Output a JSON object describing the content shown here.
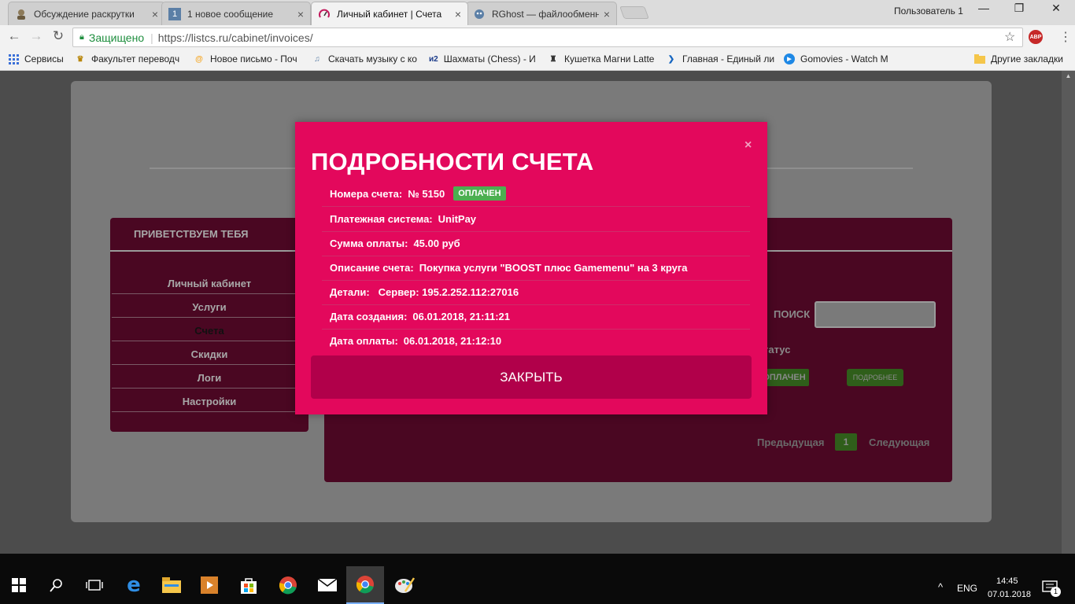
{
  "browser": {
    "tabs": [
      {
        "title": "Обсуждение раскрутки",
        "icon": "user-avatar-icon"
      },
      {
        "title": "1 новое сообщение",
        "icon": "message-icon",
        "badge": "1"
      },
      {
        "title": "Личный кабинет | Счета",
        "icon": "gauge-icon"
      },
      {
        "title": "RGhost — файлообменн",
        "icon": "ghost-icon"
      }
    ],
    "user": "Пользователь 1",
    "secure_label": "Защищено",
    "url": "https://listcs.ru/cabinet/invoices/",
    "abp": "ABP",
    "bookmarks": [
      {
        "label": "Сервисы",
        "icon": "apps-icon"
      },
      {
        "label": "Факультет переводч",
        "icon": "faculty-icon"
      },
      {
        "label": "Новое письмо - Поч",
        "icon": "mail-icon"
      },
      {
        "label": "Скачать музыку с ко",
        "icon": "music-icon"
      },
      {
        "label": "Шахматы (Chess) - И",
        "icon": "chess-icon",
        "prefix": "и2"
      },
      {
        "label": "Кушетка Магни Latte",
        "icon": "couch-icon"
      },
      {
        "label": "Главная - Единый ли",
        "icon": "gis-icon"
      },
      {
        "label": "Gomovies - Watch M",
        "icon": "play-icon"
      }
    ],
    "other_bookmarks": "Другие закладки"
  },
  "page": {
    "sidebar": {
      "greeting": "ПРИВЕТСТВУЕМ ТЕБЯ",
      "items": [
        "Личный кабинет",
        "Услуги",
        "Счета",
        "Скидки",
        "Логи",
        "Настройки"
      ],
      "active_index": 2
    },
    "search_label": "ПОИСК",
    "status_label": "татус",
    "row_status": "ОПЛАЧЕН",
    "details_button": "ПОДРОБНЕЕ",
    "pagination": {
      "prev": "Предыдущая",
      "current": "1",
      "next": "Следующая"
    }
  },
  "modal": {
    "title": "ПОДРОБНОСТИ СЧЕТА",
    "close_icon": "×",
    "invoice_label": "Номера счета:",
    "invoice_value": "№ 5150",
    "status_badge": "ОПЛАЧЕН",
    "payment_label": "Платежная система:",
    "payment_value": "UnitPay",
    "amount_label": "Сумма оплаты:",
    "amount_value": "45.00 руб",
    "desc_label": "Описание счета:",
    "desc_value": "Покупка услуги \"BOOST плюс Gamemenu\" на 3 круга",
    "details_label": "Детали:",
    "details_value": "Сервер: 195.2.252.112:27016",
    "created_label": "Дата создания:",
    "created_value": "06.01.2018, 21:11:21",
    "paid_label": "Дата оплаты:",
    "paid_value": "06.01.2018, 21:12:10",
    "close_button": "ЗАКРЫТЬ"
  },
  "taskbar": {
    "lang": "ENG",
    "time": "14:45",
    "date": "07.01.2018",
    "notifications": "1"
  },
  "colors": {
    "modal_bg": "#e3085c",
    "close_btn": "#b1004a",
    "paid_green": "#4caf50",
    "panel": "#4a0722"
  }
}
